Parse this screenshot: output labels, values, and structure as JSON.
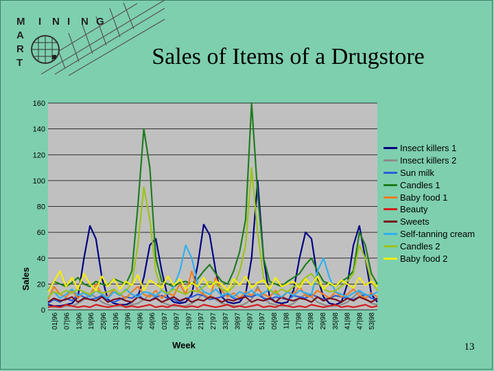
{
  "slide": {
    "title": "Sales of Items of a Drugstore",
    "page_number": "13",
    "logo_letters": [
      "M",
      "I",
      "N",
      "I",
      "N",
      "G",
      "A",
      "R",
      "T"
    ]
  },
  "chart_data": {
    "type": "line",
    "title": "",
    "xlabel": "Week",
    "ylabel": "Sales",
    "ylim": [
      0,
      160
    ],
    "yticks": [
      0,
      20,
      40,
      60,
      80,
      100,
      120,
      140,
      160
    ],
    "grid": true,
    "legend_position": "right",
    "x_tick_labels": [
      "01|96",
      "07|96",
      "13|96",
      "19|96",
      "25|96",
      "31|96",
      "37|96",
      "43|96",
      "49|96",
      "03|97",
      "09|97",
      "15|97",
      "21|97",
      "27|97",
      "33|97",
      "39|97",
      "45|97",
      "51|97",
      "05|98",
      "11|98",
      "17|98",
      "23|98",
      "29|98",
      "35|98",
      "41|98",
      "47|98",
      "53|98"
    ],
    "series": [
      {
        "name": "Insect killers 1",
        "color": "#000080",
        "values": [
          4,
          3,
          3,
          4,
          5,
          10,
          40,
          65,
          55,
          25,
          8,
          5,
          4,
          4,
          6,
          10,
          25,
          50,
          55,
          30,
          10,
          6,
          5,
          6,
          12,
          35,
          66,
          58,
          30,
          10,
          6,
          5,
          6,
          12,
          40,
          100,
          40,
          10,
          6,
          5,
          6,
          15,
          40,
          60,
          55,
          25,
          10,
          5,
          4,
          6,
          20,
          50,
          65,
          40,
          12,
          6
        ]
      },
      {
        "name": "Insect killers 2",
        "color": "#8c8c8c",
        "values": [
          3,
          2,
          2,
          3,
          3,
          5,
          8,
          12,
          10,
          6,
          4,
          3,
          3,
          3,
          4,
          5,
          8,
          12,
          10,
          6,
          4,
          3,
          3,
          3,
          5,
          8,
          14,
          12,
          8,
          5,
          4,
          3,
          3,
          5,
          8,
          18,
          9,
          5,
          4,
          3,
          3,
          5,
          9,
          12,
          10,
          6,
          4,
          3,
          3,
          4,
          6,
          10,
          14,
          9,
          5,
          4
        ]
      },
      {
        "name": "Sun milk",
        "color": "#2a5fd6",
        "values": [
          5,
          8,
          6,
          9,
          7,
          12,
          10,
          8,
          9,
          11,
          7,
          6,
          8,
          10,
          9,
          12,
          8,
          7,
          10,
          11,
          9,
          8,
          6,
          9,
          10,
          12,
          11,
          8,
          9,
          10,
          12,
          9,
          8,
          11,
          10,
          12,
          9,
          8,
          10,
          9,
          8,
          11,
          10,
          9,
          12,
          10,
          8,
          9,
          11,
          10,
          9,
          8,
          10,
          12,
          9,
          8
        ]
      },
      {
        "name": "Candles 1",
        "color": "#1e7d1e",
        "values": [
          15,
          22,
          20,
          18,
          21,
          25,
          20,
          18,
          22,
          20,
          19,
          24,
          22,
          20,
          30,
          80,
          140,
          110,
          40,
          22,
          20,
          18,
          21,
          22,
          20,
          24,
          30,
          35,
          28,
          22,
          20,
          30,
          45,
          70,
          160,
          90,
          40,
          22,
          20,
          18,
          22,
          25,
          28,
          35,
          40,
          30,
          22,
          20,
          18,
          22,
          25,
          30,
          60,
          50,
          28,
          20
        ]
      },
      {
        "name": "Baby food 1",
        "color": "#f07d1e",
        "values": [
          8,
          18,
          12,
          10,
          15,
          9,
          14,
          11,
          20,
          12,
          10,
          16,
          12,
          9,
          14,
          18,
          12,
          10,
          15,
          9,
          13,
          11,
          20,
          12,
          30,
          15,
          12,
          9,
          25,
          15,
          10,
          13,
          9,
          14,
          11,
          16,
          12,
          10,
          15,
          9,
          14,
          12,
          18,
          11,
          10,
          15,
          12,
          9,
          14,
          10,
          12,
          16,
          11,
          9,
          13,
          10
        ]
      },
      {
        "name": "Beauty",
        "color": "#d41c1c",
        "values": [
          2,
          3,
          2,
          4,
          3,
          2,
          3,
          2,
          4,
          3,
          2,
          3,
          4,
          2,
          3,
          2,
          3,
          4,
          2,
          3,
          2,
          4,
          3,
          2,
          3,
          2,
          4,
          3,
          2,
          3,
          4,
          2,
          3,
          2,
          3,
          4,
          2,
          3,
          2,
          4,
          3,
          2,
          3,
          2,
          4,
          3,
          2,
          3,
          4,
          2,
          3,
          2,
          3,
          4,
          2,
          3
        ]
      },
      {
        "name": "Sweets",
        "color": "#7a0a1a",
        "values": [
          6,
          9,
          7,
          8,
          10,
          6,
          9,
          8,
          7,
          10,
          6,
          8,
          9,
          7,
          6,
          10,
          8,
          7,
          9,
          6,
          8,
          10,
          7,
          9,
          6,
          8,
          7,
          10,
          9,
          6,
          8,
          7,
          9,
          10,
          6,
          8,
          7,
          9,
          6,
          10,
          8,
          7,
          9,
          8,
          6,
          10,
          7,
          9,
          8,
          6,
          9,
          7,
          10,
          8,
          6,
          9
        ]
      },
      {
        "name": "Self-tanning cream",
        "color": "#2fb0f0",
        "values": [
          10,
          14,
          9,
          12,
          16,
          11,
          13,
          10,
          15,
          12,
          9,
          14,
          11,
          16,
          12,
          10,
          14,
          13,
          11,
          15,
          12,
          18,
          30,
          50,
          40,
          20,
          14,
          12,
          16,
          11,
          13,
          10,
          14,
          12,
          15,
          11,
          13,
          16,
          12,
          10,
          14,
          11,
          15,
          13,
          12,
          30,
          40,
          25,
          14,
          12,
          10,
          13,
          15,
          12,
          11,
          14
        ]
      },
      {
        "name": "Candles 2",
        "color": "#9ac41a",
        "values": [
          10,
          14,
          12,
          15,
          13,
          16,
          14,
          12,
          15,
          13,
          14,
          16,
          12,
          15,
          20,
          50,
          95,
          70,
          30,
          15,
          13,
          16,
          14,
          12,
          15,
          14,
          18,
          22,
          20,
          16,
          14,
          18,
          30,
          50,
          110,
          60,
          25,
          15,
          13,
          16,
          14,
          18,
          20,
          25,
          28,
          22,
          16,
          14,
          15,
          18,
          22,
          28,
          50,
          40,
          22,
          15
        ]
      },
      {
        "name": "Baby food 2",
        "color": "#f5ef00",
        "values": [
          14,
          22,
          30,
          18,
          25,
          16,
          28,
          20,
          15,
          26,
          18,
          24,
          16,
          22,
          19,
          27,
          15,
          23,
          20,
          17,
          26,
          19,
          24,
          16,
          21,
          18,
          25,
          17,
          22,
          20,
          15,
          24,
          19,
          26,
          17,
          21,
          23,
          16,
          25,
          18,
          20,
          22,
          17,
          24,
          19,
          26,
          16,
          21,
          18,
          23,
          20,
          17,
          25,
          19,
          22,
          18
        ]
      }
    ]
  }
}
